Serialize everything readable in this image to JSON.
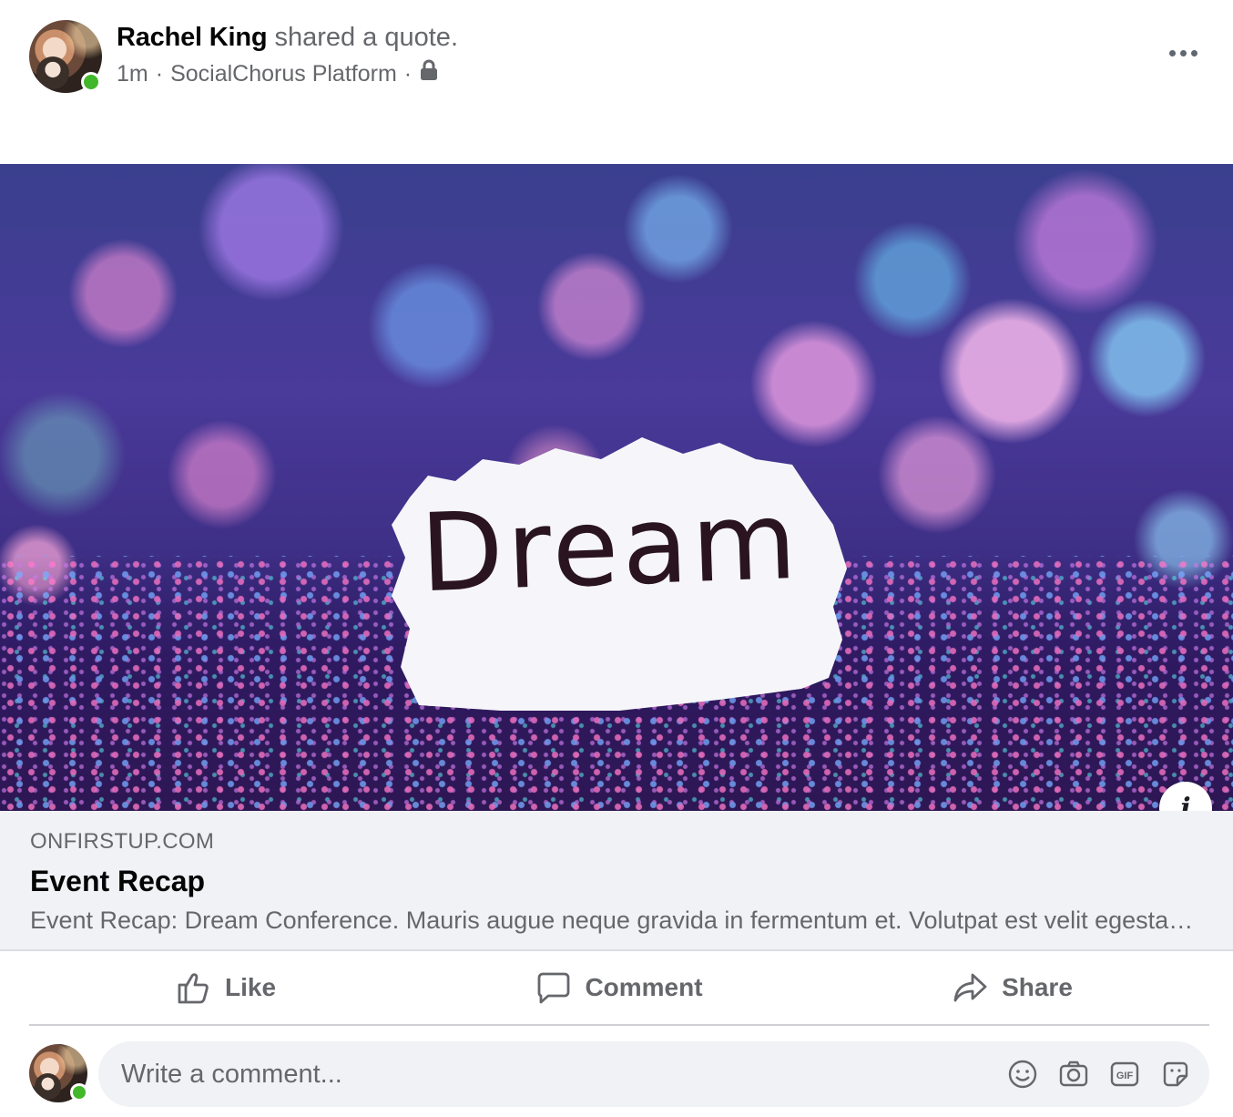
{
  "post": {
    "author_name": "Rachel King",
    "action_text": "shared a quote.",
    "timestamp": "1m",
    "separator": "·",
    "platform": "SocialChorus Platform",
    "privacy_icon": "lock-icon",
    "more_icon": "more-options-icon"
  },
  "image": {
    "caption_word": "Dream"
  },
  "link_preview": {
    "domain": "ONFIRSTUP.COM",
    "title": "Event Recap",
    "description": "Event Recap: Dream Conference. Mauris augue neque gravida in fermentum et. Volutpat est velit egestas dui id ornare arcu odio ut sem nulla pharetra diam."
  },
  "actions": {
    "like": "Like",
    "comment": "Comment",
    "share": "Share"
  },
  "comment_box": {
    "placeholder": "Write a comment..."
  },
  "colors": {
    "presence": "#42b72a",
    "secondary_text": "#65676b",
    "link_bg": "#f0f2f5"
  }
}
